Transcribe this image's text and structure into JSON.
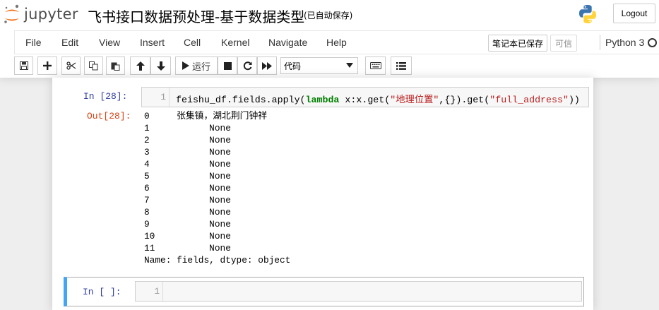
{
  "header": {
    "logo_text": "jupyter",
    "notebook_title": "飞书接口数据预处理-基于数据类型",
    "autosave_status": "(已自动保存)",
    "logout_label": "Logout"
  },
  "menubar": {
    "items": [
      "File",
      "Edit",
      "View",
      "Insert",
      "Cell",
      "Kernel",
      "Navigate",
      "Help"
    ],
    "saved_status": "笔记本已保存",
    "trusted_label": "可信",
    "kernel_name": "Python 3"
  },
  "toolbar": {
    "run_label": "运行",
    "cell_type": "代码",
    "buttons": [
      "save-icon",
      "add-icon",
      "cut-icon",
      "copy-icon",
      "paste-icon",
      "move-up-icon",
      "move-down-icon",
      "run-icon",
      "stop-icon",
      "restart-icon",
      "fast-forward-icon",
      "keyboard-icon",
      "command-palette-icon"
    ]
  },
  "cells": [
    {
      "prompt": "In  [28]:",
      "line_number": "1",
      "code": {
        "part1": "feishu_df.fields.apply(",
        "keyword": "lambda",
        "part2": " x:x.get(",
        "string1": "\"地理位置\"",
        "part3": ",{}).get(",
        "string2": "\"full_address\"",
        "part4": "))"
      },
      "output_prompt": "Out[28]:",
      "output": "0     张集镇，湖北荆门钟祥\n1           None\n2           None\n3           None\n4           None\n5           None\n6           None\n7           None\n8           None\n9           None\n10          None\n11          None\nName: fields, dtype: object"
    },
    {
      "prompt": "In  [ ]:",
      "line_number": "1",
      "code": ""
    }
  ],
  "colors": {
    "input_prompt": "#303f9f",
    "output_prompt": "#d84315",
    "selected_cell_border": "#42a5f5",
    "keyword": "#008000",
    "string": "#ba2121"
  }
}
